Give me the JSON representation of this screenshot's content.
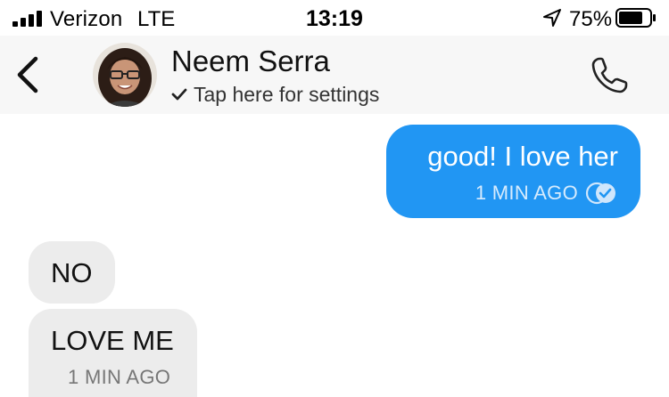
{
  "status_bar": {
    "carrier": "Verizon",
    "network": "LTE",
    "time": "13:19",
    "battery": "75%",
    "battery_level": 0.75,
    "signal_bars": 4
  },
  "header": {
    "contact_name": "Neem Serra",
    "settings_text": "Tap here for settings",
    "icons": [
      "chevron-left-icon",
      "checkmark-icon",
      "phone-icon"
    ]
  },
  "messages": [
    {
      "direction": "outgoing",
      "text": "good! I love her",
      "time": "1 MIN AGO",
      "status_icon": "seen-icon"
    },
    {
      "direction": "incoming",
      "text": "NO"
    },
    {
      "direction": "incoming",
      "text": "LOVE ME",
      "time": "1 MIN AGO"
    }
  ],
  "colors": {
    "outgoing_bubble": "#2196f3",
    "incoming_bubble": "#ececec",
    "header_bg": "#f7f7f7"
  }
}
